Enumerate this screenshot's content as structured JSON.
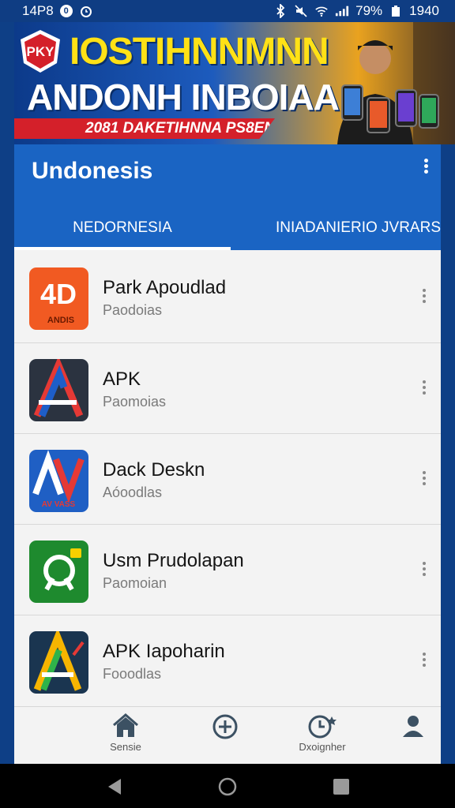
{
  "status_bar": {
    "left_text": "14P8",
    "badge_text": "0",
    "battery_text": "79%",
    "time": "1940",
    "icons": [
      "notification-circle-icon",
      "alarm-icon",
      "bluetooth-icon",
      "mute-icon",
      "wifi-icon",
      "signal-icon",
      "battery-icon"
    ]
  },
  "banner": {
    "logo_text": "PKY",
    "title": "IOSTIHNNMNN",
    "subtitle": "ANDONH INBOIAA",
    "ribbon": "2081 DAKETIHNNA PS8EN",
    "colors": {
      "title": "#ffe116",
      "ribbon": "#d4202a"
    }
  },
  "app": {
    "title": "Undonesis",
    "tabs": [
      {
        "label": "NEDORNESIA",
        "active": true
      },
      {
        "label": "INIADANIERIO JVRARS",
        "active": false
      }
    ],
    "accent": "#1a64c3"
  },
  "apps": [
    {
      "name": "Park Apoudlad",
      "subtitle": "Paodoias",
      "icon": "4d-app-icon",
      "icon_text": "4D",
      "icon_caption": "ANDIS"
    },
    {
      "name": "APK",
      "subtitle": "Paomoias",
      "icon": "apk-a-app-icon"
    },
    {
      "name": "Dack Deskn",
      "subtitle": "Aóoodlas",
      "icon": "av-app-icon",
      "icon_caption": "AV VASS"
    },
    {
      "name": "Usm Prudolapan",
      "subtitle": "Paomoian",
      "icon": "p-app-icon"
    },
    {
      "name": "APK Iapoharin",
      "subtitle": "Fooodlas",
      "icon": "apk-green-app-icon"
    }
  ],
  "bottom_nav": [
    {
      "label": "Sensie",
      "icon": "home-icon"
    },
    {
      "label": "",
      "icon": "add-circle-icon"
    },
    {
      "label": "Dxoignher",
      "icon": "clock-icon"
    },
    {
      "label": "",
      "icon": "profile-icon"
    }
  ],
  "system_nav": [
    "back-icon",
    "home-circle-icon",
    "recents-icon"
  ]
}
